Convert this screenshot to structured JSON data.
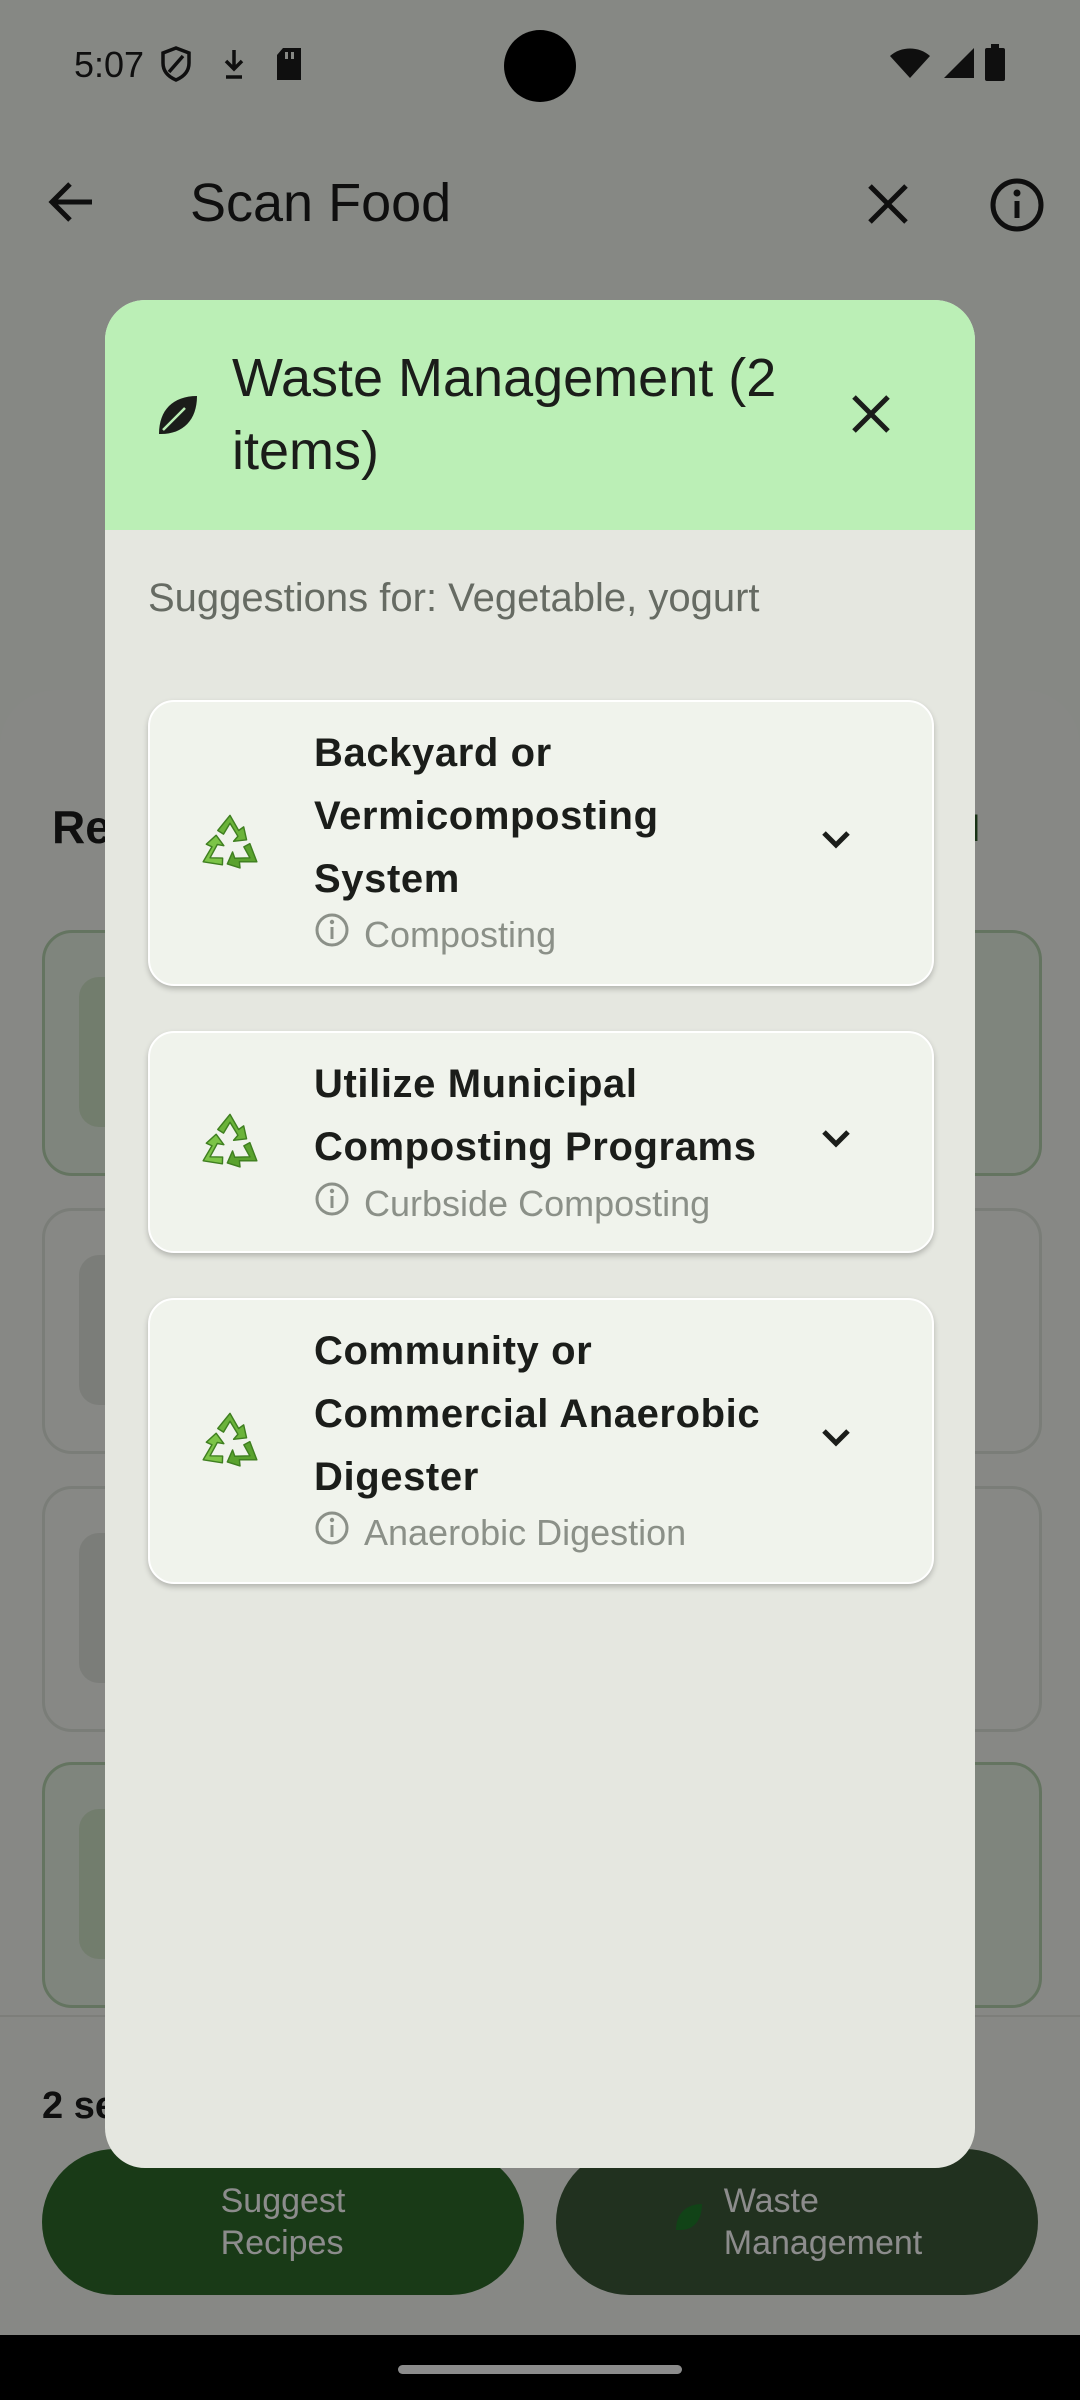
{
  "status_bar": {
    "time": "5:07",
    "left_icons": [
      "shield-icon",
      "download-icon",
      "sd-card-icon"
    ],
    "right_icons": [
      "wifi-icon",
      "signal-icon",
      "battery-icon"
    ]
  },
  "app_bar": {
    "title": "Scan Food",
    "icons": [
      "back-arrow-icon",
      "close-icon",
      "info-icon"
    ]
  },
  "background_screen": {
    "section_heading": "Re",
    "view_all": "ll",
    "selection_count": "2 se",
    "buttons": [
      {
        "label": "Suggest Recipes",
        "line1": "Suggest",
        "line2": "Recipes"
      },
      {
        "label": "Waste Management",
        "line1": "Waste",
        "line2": "Management"
      }
    ]
  },
  "dialog": {
    "title": "Waste Management (2 items)",
    "header_icon": "leaf-icon",
    "close_icon": "close-icon",
    "suggestions_label": "Suggestions for: Vegetable, yogurt",
    "options": [
      {
        "title": "Backyard or Vermicomposting System",
        "subtitle": "Composting",
        "icon": "recycle-icon"
      },
      {
        "title": "Utilize Municipal Composting Programs",
        "subtitle": "Curbside Composting",
        "icon": "recycle-icon"
      },
      {
        "title": "Community or Commercial Anaerobic Digester",
        "subtitle": "Anaerobic Digestion",
        "icon": "recycle-icon"
      }
    ]
  },
  "colors": {
    "dialog_header": "#bbefb6",
    "dialog_body": "#e5e7e0",
    "primary_button": "#2e6b2b",
    "recycle_green": "#6bb33a"
  }
}
